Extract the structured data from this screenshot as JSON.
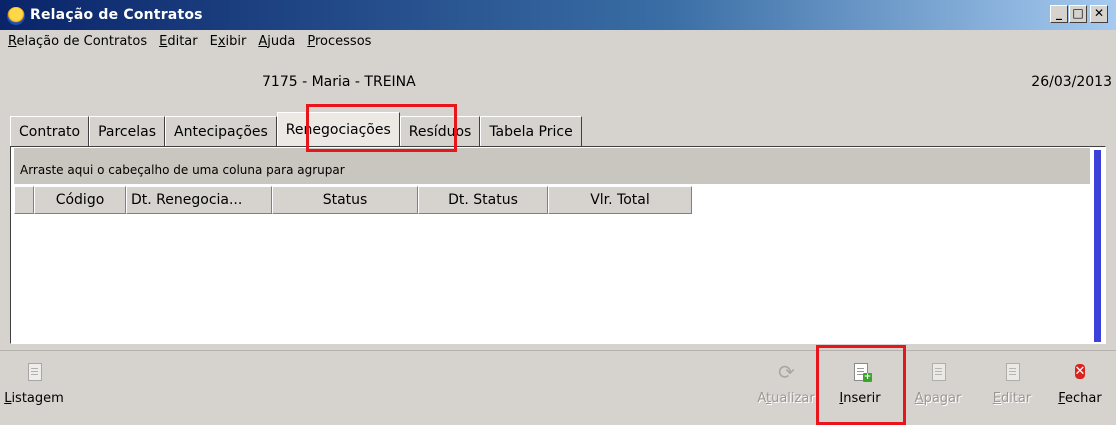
{
  "window": {
    "title": "Relação de Contratos",
    "buttons": {
      "minimize": "_",
      "maximize": "□",
      "close": "✕"
    }
  },
  "menu": [
    {
      "pre": "",
      "u": "R",
      "post": "elação de Contratos"
    },
    {
      "pre": "",
      "u": "E",
      "post": "ditar"
    },
    {
      "pre": "E",
      "u": "x",
      "post": "ibir"
    },
    {
      "pre": "",
      "u": "A",
      "post": "juda"
    },
    {
      "pre": "",
      "u": "P",
      "post": "rocessos"
    }
  ],
  "info": {
    "user": "7175 - Maria - TREINA",
    "date": "26/03/2013"
  },
  "tabs": [
    {
      "label": "Contrato",
      "active": false
    },
    {
      "label": "Parcelas",
      "active": false
    },
    {
      "label": "Antecipações",
      "active": false
    },
    {
      "label": "Renegociações",
      "active": true
    },
    {
      "label": "Resíduos",
      "active": false
    },
    {
      "label": "Tabela Price",
      "active": false
    }
  ],
  "grid": {
    "group_hint": "Arraste aqui o cabeçalho de uma coluna para agrupar",
    "columns": [
      "Código",
      "Dt. Renegocia...",
      "Status",
      "Dt. Status",
      "Vlr. Total"
    ],
    "rows": []
  },
  "toolbar": {
    "listagem": {
      "u": "L",
      "rest": "istagem"
    },
    "atualizar": {
      "u": "t",
      "pre": "A",
      "rest": "ualizar"
    },
    "inserir": {
      "u": "I",
      "rest": "nserir"
    },
    "apagar": {
      "u": "A",
      "rest": "pagar"
    },
    "editar": {
      "u": "E",
      "rest": "ditar"
    },
    "fechar": {
      "u": "F",
      "rest": "echar"
    }
  },
  "icons": {
    "app": "app-logo-icon",
    "listagem": "report-document-icon",
    "atualizar": "refresh-icon",
    "inserir": "new-document-icon",
    "apagar": "delete-document-icon",
    "editar": "edit-document-icon",
    "fechar": "close-icon"
  },
  "colors": {
    "highlight": "#e8151d",
    "scrollbar": "#3c41d9",
    "title_gradient_start": "#0a246a"
  }
}
